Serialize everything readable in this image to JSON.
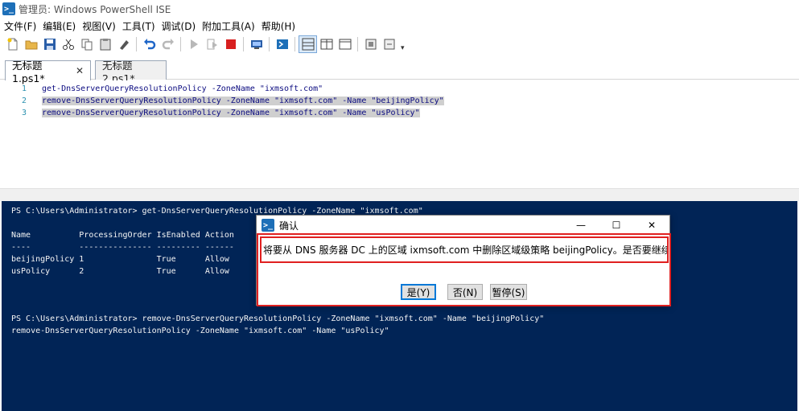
{
  "window": {
    "title": "管理员: Windows PowerShell ISE"
  },
  "menu": {
    "items": [
      "文件(F)",
      "编辑(E)",
      "视图(V)",
      "工具(T)",
      "调试(D)",
      "附加工具(A)",
      "帮助(H)"
    ]
  },
  "toolbar": {
    "icons": [
      "new-file-icon",
      "open-folder-icon",
      "save-icon",
      "cut-icon",
      "copy-icon",
      "paste-icon",
      "clear-icon",
      "undo-icon",
      "redo-icon",
      "run-icon",
      "run-selection-icon",
      "stop-icon",
      "new-remote-tab-icon",
      "powershell-icon",
      "layout-top-icon",
      "layout-right-icon",
      "layout-max-icon",
      "show-commands-icon",
      "addon-icon"
    ]
  },
  "tabs": [
    {
      "label": "无标题1.ps1*",
      "close": "✕",
      "active": true
    },
    {
      "label": "无标题2.ps1*",
      "active": false
    }
  ],
  "editor": {
    "lines": [
      {
        "number": "1",
        "code": "get-DnsServerQueryResolutionPolicy -ZoneName \"ixmsoft.com\"",
        "selected": false
      },
      {
        "number": "2",
        "code": "remove-DnsServerQueryResolutionPolicy -ZoneName \"ixmsoft.com\" -Name \"beijingPolicy\"",
        "selected": true
      },
      {
        "number": "3",
        "code": "remove-DnsServerQueryResolutionPolicy -ZoneName \"ixmsoft.com\" -Name \"usPolicy\"",
        "selected": true
      }
    ]
  },
  "console": {
    "lines": [
      "PS C:\\Users\\Administrator> get-DnsServerQueryResolutionPolicy -ZoneName \"ixmsoft.com\"",
      "",
      "Name          ProcessingOrder IsEnabled Action",
      "----          --------------- --------- ------",
      "beijingPolicy 1               True      Allow",
      "usPolicy      2               True      Allow",
      "",
      "",
      "",
      "",
      "PS C:\\Users\\Administrator> remove-DnsServerQueryResolutionPolicy -ZoneName \"ixmsoft.com\" -Name \"beijingPolicy\"",
      "remove-DnsServerQueryResolutionPolicy -ZoneName \"ixmsoft.com\" -Name \"usPolicy\""
    ]
  },
  "dialog": {
    "title": "确认",
    "minimize": "—",
    "maximize": "☐",
    "close": "✕",
    "message": "将要从 DNS 服务器 DC 上的区域 ixmsoft.com 中删除区域级策略 beijingPolicy。是否要继续?",
    "buttons": {
      "yes": "是(Y)",
      "no": "否(N)",
      "suspend": "暂停(S)"
    },
    "highlight_color": "#e02020"
  },
  "colors": {
    "console_background": "#012456",
    "console_text": "#f5f5f5",
    "editor_text": "#0b0b80",
    "line_number": "#2b91af",
    "selection": "#cfcfcf"
  }
}
